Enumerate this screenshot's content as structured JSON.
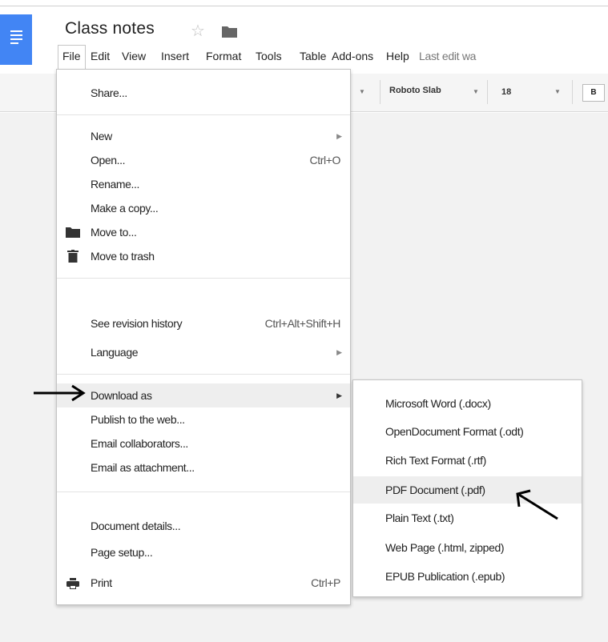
{
  "document": {
    "title": "Class notes"
  },
  "menubar": {
    "items": [
      "File",
      "Edit",
      "View",
      "Insert",
      "Format",
      "Tools",
      "Table",
      "Add-ons",
      "Help"
    ],
    "last_edit": "Last edit wa"
  },
  "toolbar": {
    "font": "Roboto Slab",
    "font_size": "18",
    "bold": "B"
  },
  "file_menu": {
    "items": [
      {
        "label": "Share..."
      },
      {
        "label": "New"
      },
      {
        "label": "Open...",
        "shortcut": "Ctrl+O"
      },
      {
        "label": "Rename..."
      },
      {
        "label": "Make a copy..."
      },
      {
        "label": "Move to...",
        "icon": "folder-icon"
      },
      {
        "label": "Move to trash",
        "icon": "trash-icon"
      },
      {
        "label": "See revision history",
        "shortcut": "Ctrl+Alt+Shift+H"
      },
      {
        "label": "Language"
      },
      {
        "label": "Download as"
      },
      {
        "label": "Publish to the web..."
      },
      {
        "label": "Email collaborators..."
      },
      {
        "label": "Email as attachment..."
      },
      {
        "label": "Document details..."
      },
      {
        "label": "Page setup..."
      },
      {
        "label": "Print",
        "shortcut": "Ctrl+P",
        "icon": "print-icon"
      }
    ]
  },
  "download_submenu": {
    "items": [
      "Microsoft Word (.docx)",
      "OpenDocument Format (.odt)",
      "Rich Text Format (.rtf)",
      "PDF Document (.pdf)",
      "Plain Text (.txt)",
      "Web Page (.html, zipped)",
      "EPUB Publication (.epub)"
    ],
    "highlighted": "PDF Document (.pdf)"
  },
  "colors": {
    "docs_blue": "#4285f4",
    "menu_highlight": "#eeeeee",
    "annotation_arrow": "#000000"
  }
}
